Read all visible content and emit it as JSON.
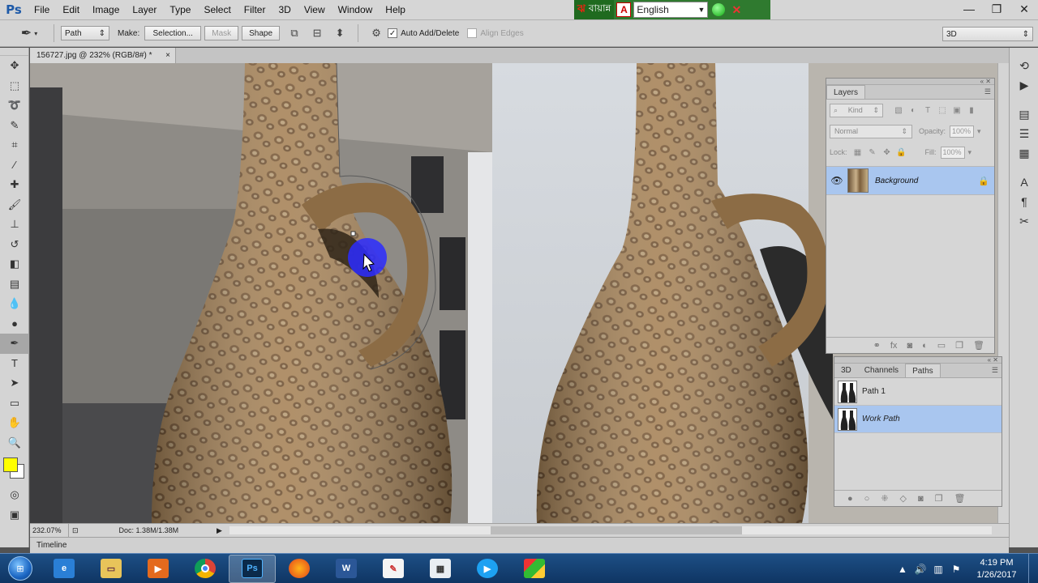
{
  "app": {
    "logo": "Ps",
    "menu": [
      "File",
      "Edit",
      "Image",
      "Layer",
      "Type",
      "Select",
      "Filter",
      "3D",
      "View",
      "Window",
      "Help"
    ]
  },
  "language_bar": {
    "bangla_label": "বায়ান্ন",
    "language": "English"
  },
  "options_bar": {
    "mode": "Path",
    "make_label": "Make:",
    "selection_button": "Selection...",
    "mask_button": "Mask",
    "shape_button": "Shape",
    "auto_add_delete": "Auto Add/Delete",
    "auto_add_delete_checked": true,
    "align_edges": "Align Edges",
    "align_edges_checked": false,
    "workspace": "3D"
  },
  "document": {
    "tab_title": "156727.jpg @ 232% (RGB/8#) *"
  },
  "colors": {
    "foreground": "#ffff00",
    "background": "#ffffff",
    "selection_highlight": "#a9c6ef",
    "anchor_marker": "#2b2bff"
  },
  "layers_panel": {
    "tab": "Layers",
    "kind_label": "Kind",
    "blend_mode": "Normal",
    "opacity_label": "Opacity:",
    "opacity": "100%",
    "lock_label": "Lock:",
    "fill_label": "Fill:",
    "fill": "100%",
    "layers": [
      {
        "name": "Background",
        "visible": true,
        "locked": true,
        "selected": true
      }
    ]
  },
  "paths_panel": {
    "tabs": [
      "3D",
      "Channels",
      "Paths"
    ],
    "active_tab": "Paths",
    "paths": [
      {
        "name": "Path 1",
        "selected": false
      },
      {
        "name": "Work Path",
        "selected": true
      }
    ]
  },
  "status_bar": {
    "zoom": "232.07%",
    "doc_size": "Doc: 1.38M/1.38M"
  },
  "timeline": {
    "label": "Timeline"
  },
  "taskbar": {
    "apps": [
      "start",
      "internet-explorer",
      "file-explorer",
      "media-player",
      "chrome",
      "photoshop",
      "firefox",
      "word",
      "paint",
      "calculator",
      "video-player",
      "colored-app"
    ],
    "active_app": "photoshop",
    "time": "4:19 PM",
    "date": "1/26/2017"
  }
}
